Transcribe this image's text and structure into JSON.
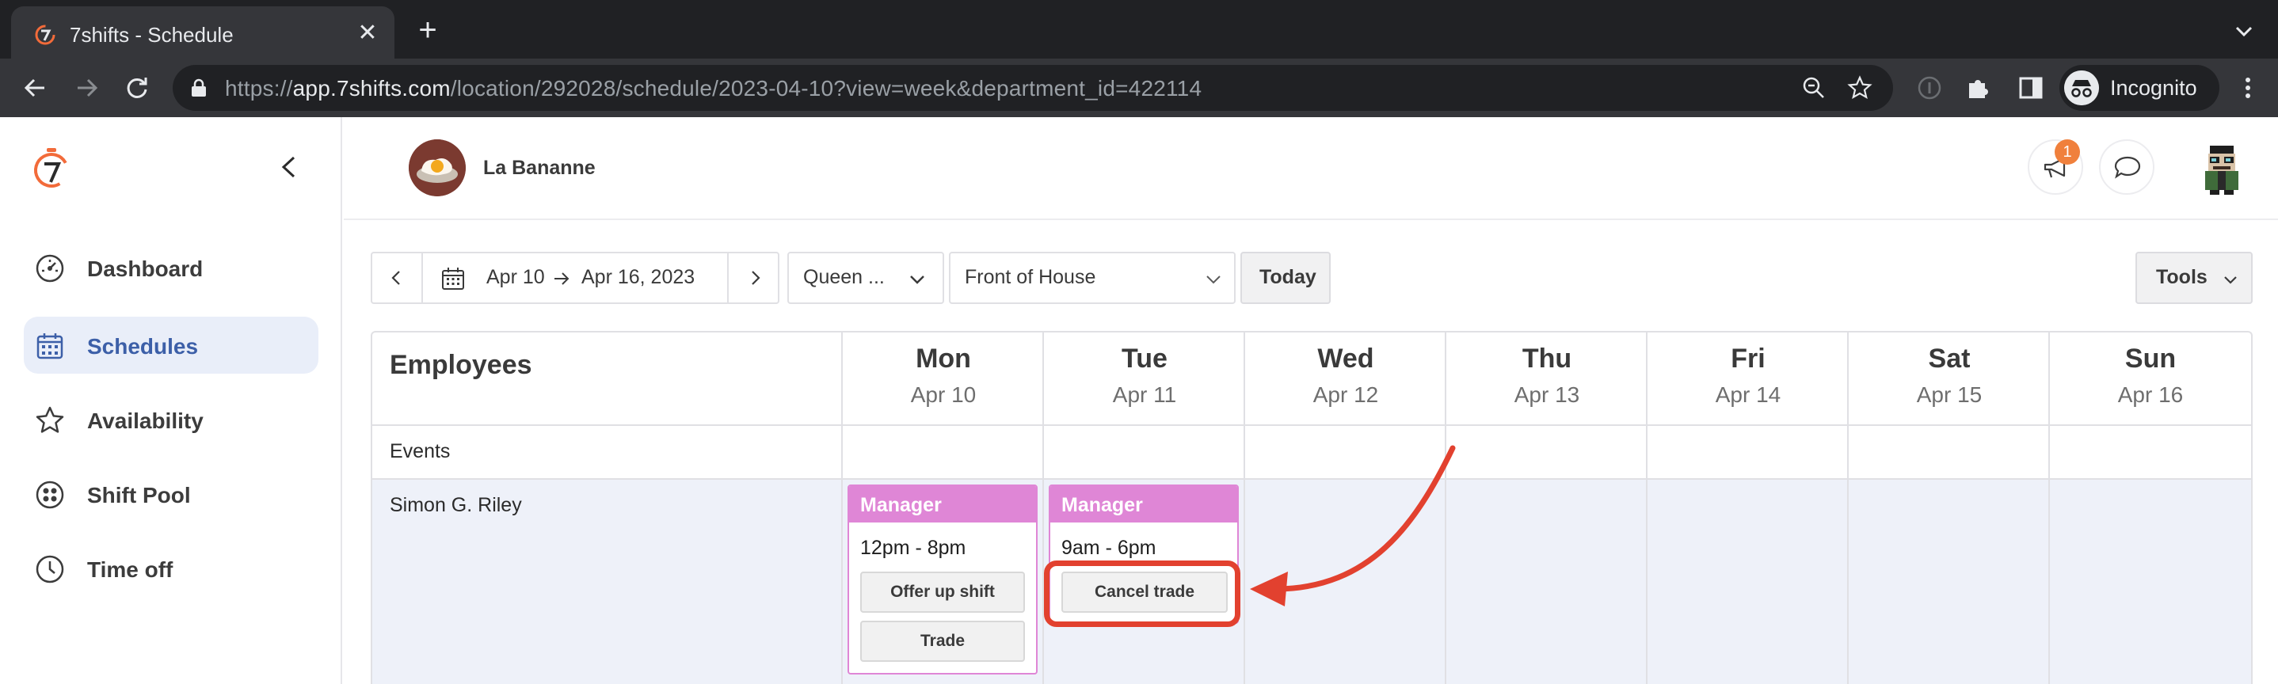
{
  "browser": {
    "tab_title": "7shifts - Schedule",
    "url_prefix": "https://",
    "url_host": "app.7shifts.com",
    "url_path": "/location/292028/schedule/2023-04-10?view=week&department_id=422114",
    "profile_label": "Incognito",
    "icons": [
      "back-icon",
      "forward-icon",
      "reload-icon",
      "lock-icon",
      "zoom-icon",
      "star-icon",
      "info-icon",
      "extensions-icon",
      "side-panel-icon",
      "more-icon"
    ]
  },
  "sidebar": {
    "items": [
      {
        "label": "Dashboard",
        "icon": "dashboard-icon"
      },
      {
        "label": "Schedules",
        "icon": "calendar-icon",
        "active": true
      },
      {
        "label": "Availability",
        "icon": "star-icon"
      },
      {
        "label": "Shift Pool",
        "icon": "shift-pool-icon"
      },
      {
        "label": "Time off",
        "icon": "clock-icon"
      }
    ]
  },
  "header": {
    "company": "La Bananne",
    "notification_count": "1"
  },
  "controls": {
    "date_start": "Apr 10",
    "date_end": "Apr 16, 2023",
    "location": "Queen ...",
    "department": "Front of House",
    "today_label": "Today",
    "tools_label": "Tools"
  },
  "schedule": {
    "employees_header": "Employees",
    "events_label": "Events",
    "days": [
      {
        "name": "Mon",
        "date": "Apr 10"
      },
      {
        "name": "Tue",
        "date": "Apr 11"
      },
      {
        "name": "Wed",
        "date": "Apr 12"
      },
      {
        "name": "Thu",
        "date": "Apr 13"
      },
      {
        "name": "Fri",
        "date": "Apr 14"
      },
      {
        "name": "Sat",
        "date": "Apr 15"
      },
      {
        "name": "Sun",
        "date": "Apr 16"
      }
    ],
    "employee": "Simon G. Riley",
    "shifts": [
      {
        "role": "Manager",
        "time": "12pm - 8pm",
        "actions": [
          "Offer up shift",
          "Trade"
        ]
      },
      {
        "role": "Manager",
        "time": "9am - 6pm",
        "actions": [
          "Cancel trade"
        ]
      }
    ]
  },
  "colors": {
    "shift_role": "#df86d6",
    "annotation": "#e2412f",
    "active_nav": "#3c5fa8",
    "row_band": "#eef1f9"
  }
}
